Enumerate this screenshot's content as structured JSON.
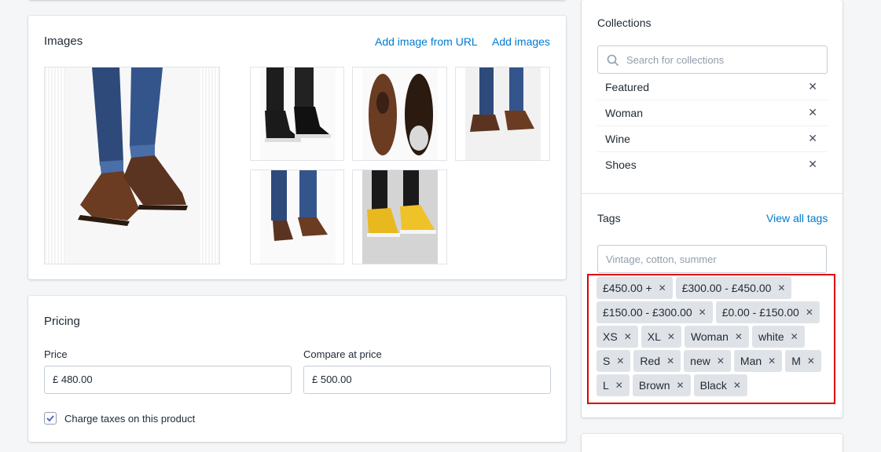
{
  "images": {
    "title": "Images",
    "add_from_url": "Add image from URL",
    "add_images": "Add images",
    "thumbs": [
      {
        "icon": "brown-shoes-photo",
        "bg": "#ffffff",
        "accent": "#5a3421"
      },
      {
        "icon": "black-sneakers-photo",
        "bg": "#ffffff",
        "accent": "#1c1c1c"
      },
      {
        "icon": "brown-shoes-pair-photo",
        "bg": "#ffffff",
        "accent": "#6b3b22"
      },
      {
        "icon": "brown-shoes-side-photo",
        "bg": "#f1f1f1",
        "accent": "#5a3421"
      },
      {
        "icon": "brown-shoes-jeans-photo",
        "bg": "#ffffff",
        "accent": "#5a3421"
      },
      {
        "icon": "yellow-sneakers-photo",
        "bg": "#ffffff",
        "accent": "#e8b81f"
      }
    ]
  },
  "pricing": {
    "title": "Pricing",
    "price_label": "Price",
    "price_value": "£ 480.00",
    "compare_label": "Compare at price",
    "compare_value": "£ 500.00",
    "charge_taxes_label": "Charge taxes on this product",
    "charge_taxes_checked": true
  },
  "collections": {
    "title": "Collections",
    "search_placeholder": "Search for collections",
    "items": [
      {
        "label": "Featured"
      },
      {
        "label": "Woman"
      },
      {
        "label": "Wine"
      },
      {
        "label": "Shoes"
      }
    ]
  },
  "tags": {
    "title": "Tags",
    "view_all": "View all tags",
    "input_placeholder": "Vintage, cotton, summer",
    "items": [
      "£450.00 +",
      "£300.00 - £450.00",
      "£150.00 - £300.00",
      "£0.00 - £150.00",
      "XS",
      "XL",
      "Woman",
      "white",
      "S",
      "Red",
      "new",
      "Man",
      "M",
      "L",
      "Brown",
      "Black"
    ]
  },
  "colors": {
    "link": "#007ace",
    "tag_bg": "#dfe3e8",
    "highlight": "#e00000",
    "checkbox_accent": "#5c6ac4"
  }
}
